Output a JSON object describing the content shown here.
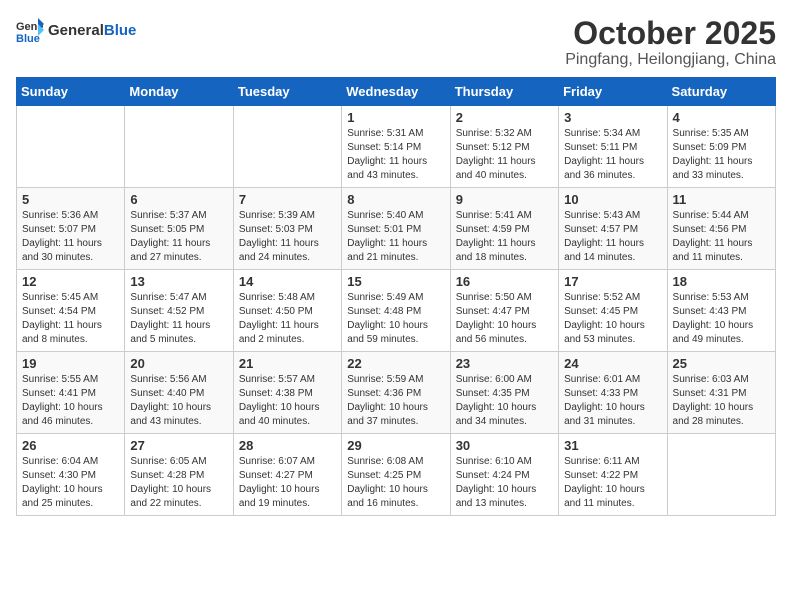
{
  "header": {
    "logo": {
      "text_general": "General",
      "text_blue": "Blue"
    },
    "month": "October 2025",
    "location": "Pingfang, Heilongjiang, China"
  },
  "weekdays": [
    "Sunday",
    "Monday",
    "Tuesday",
    "Wednesday",
    "Thursday",
    "Friday",
    "Saturday"
  ],
  "weeks": [
    [
      {
        "day": "",
        "info": ""
      },
      {
        "day": "",
        "info": ""
      },
      {
        "day": "",
        "info": ""
      },
      {
        "day": "1",
        "info": "Sunrise: 5:31 AM\nSunset: 5:14 PM\nDaylight: 11 hours\nand 43 minutes."
      },
      {
        "day": "2",
        "info": "Sunrise: 5:32 AM\nSunset: 5:12 PM\nDaylight: 11 hours\nand 40 minutes."
      },
      {
        "day": "3",
        "info": "Sunrise: 5:34 AM\nSunset: 5:11 PM\nDaylight: 11 hours\nand 36 minutes."
      },
      {
        "day": "4",
        "info": "Sunrise: 5:35 AM\nSunset: 5:09 PM\nDaylight: 11 hours\nand 33 minutes."
      }
    ],
    [
      {
        "day": "5",
        "info": "Sunrise: 5:36 AM\nSunset: 5:07 PM\nDaylight: 11 hours\nand 30 minutes."
      },
      {
        "day": "6",
        "info": "Sunrise: 5:37 AM\nSunset: 5:05 PM\nDaylight: 11 hours\nand 27 minutes."
      },
      {
        "day": "7",
        "info": "Sunrise: 5:39 AM\nSunset: 5:03 PM\nDaylight: 11 hours\nand 24 minutes."
      },
      {
        "day": "8",
        "info": "Sunrise: 5:40 AM\nSunset: 5:01 PM\nDaylight: 11 hours\nand 21 minutes."
      },
      {
        "day": "9",
        "info": "Sunrise: 5:41 AM\nSunset: 4:59 PM\nDaylight: 11 hours\nand 18 minutes."
      },
      {
        "day": "10",
        "info": "Sunrise: 5:43 AM\nSunset: 4:57 PM\nDaylight: 11 hours\nand 14 minutes."
      },
      {
        "day": "11",
        "info": "Sunrise: 5:44 AM\nSunset: 4:56 PM\nDaylight: 11 hours\nand 11 minutes."
      }
    ],
    [
      {
        "day": "12",
        "info": "Sunrise: 5:45 AM\nSunset: 4:54 PM\nDaylight: 11 hours\nand 8 minutes."
      },
      {
        "day": "13",
        "info": "Sunrise: 5:47 AM\nSunset: 4:52 PM\nDaylight: 11 hours\nand 5 minutes."
      },
      {
        "day": "14",
        "info": "Sunrise: 5:48 AM\nSunset: 4:50 PM\nDaylight: 11 hours\nand 2 minutes."
      },
      {
        "day": "15",
        "info": "Sunrise: 5:49 AM\nSunset: 4:48 PM\nDaylight: 10 hours\nand 59 minutes."
      },
      {
        "day": "16",
        "info": "Sunrise: 5:50 AM\nSunset: 4:47 PM\nDaylight: 10 hours\nand 56 minutes."
      },
      {
        "day": "17",
        "info": "Sunrise: 5:52 AM\nSunset: 4:45 PM\nDaylight: 10 hours\nand 53 minutes."
      },
      {
        "day": "18",
        "info": "Sunrise: 5:53 AM\nSunset: 4:43 PM\nDaylight: 10 hours\nand 49 minutes."
      }
    ],
    [
      {
        "day": "19",
        "info": "Sunrise: 5:55 AM\nSunset: 4:41 PM\nDaylight: 10 hours\nand 46 minutes."
      },
      {
        "day": "20",
        "info": "Sunrise: 5:56 AM\nSunset: 4:40 PM\nDaylight: 10 hours\nand 43 minutes."
      },
      {
        "day": "21",
        "info": "Sunrise: 5:57 AM\nSunset: 4:38 PM\nDaylight: 10 hours\nand 40 minutes."
      },
      {
        "day": "22",
        "info": "Sunrise: 5:59 AM\nSunset: 4:36 PM\nDaylight: 10 hours\nand 37 minutes."
      },
      {
        "day": "23",
        "info": "Sunrise: 6:00 AM\nSunset: 4:35 PM\nDaylight: 10 hours\nand 34 minutes."
      },
      {
        "day": "24",
        "info": "Sunrise: 6:01 AM\nSunset: 4:33 PM\nDaylight: 10 hours\nand 31 minutes."
      },
      {
        "day": "25",
        "info": "Sunrise: 6:03 AM\nSunset: 4:31 PM\nDaylight: 10 hours\nand 28 minutes."
      }
    ],
    [
      {
        "day": "26",
        "info": "Sunrise: 6:04 AM\nSunset: 4:30 PM\nDaylight: 10 hours\nand 25 minutes."
      },
      {
        "day": "27",
        "info": "Sunrise: 6:05 AM\nSunset: 4:28 PM\nDaylight: 10 hours\nand 22 minutes."
      },
      {
        "day": "28",
        "info": "Sunrise: 6:07 AM\nSunset: 4:27 PM\nDaylight: 10 hours\nand 19 minutes."
      },
      {
        "day": "29",
        "info": "Sunrise: 6:08 AM\nSunset: 4:25 PM\nDaylight: 10 hours\nand 16 minutes."
      },
      {
        "day": "30",
        "info": "Sunrise: 6:10 AM\nSunset: 4:24 PM\nDaylight: 10 hours\nand 13 minutes."
      },
      {
        "day": "31",
        "info": "Sunrise: 6:11 AM\nSunset: 4:22 PM\nDaylight: 10 hours\nand 11 minutes."
      },
      {
        "day": "",
        "info": ""
      }
    ]
  ]
}
